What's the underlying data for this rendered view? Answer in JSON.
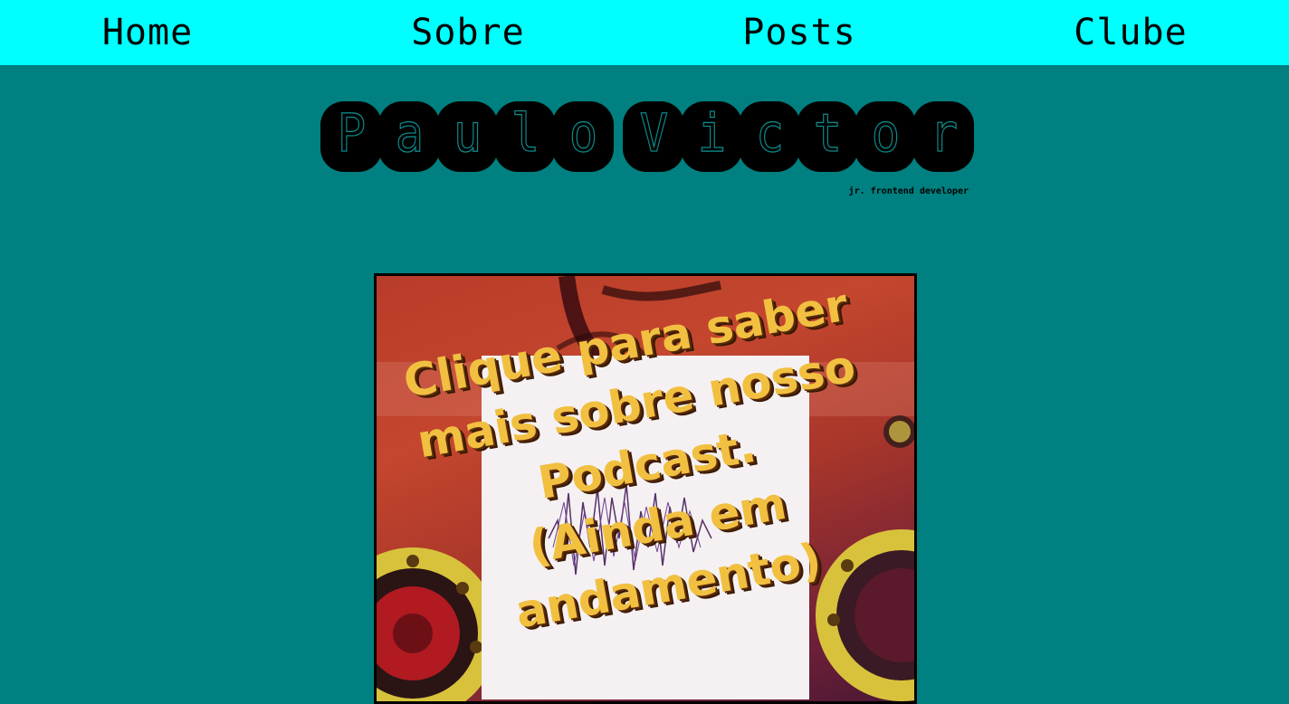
{
  "nav": {
    "items": [
      {
        "label": "Home"
      },
      {
        "label": "Sobre"
      },
      {
        "label": "Posts"
      },
      {
        "label": "Clube"
      }
    ]
  },
  "logo": {
    "letters": [
      "P",
      "a",
      "u",
      "l",
      "o",
      "V",
      "i",
      "c",
      "t",
      "o",
      "r"
    ]
  },
  "subtitle": "jr. frontend developer",
  "banner": {
    "lines": [
      "Clique para saber",
      "mais sobre nosso",
      "Podcast.",
      "(Ainda em",
      "andamento)"
    ]
  }
}
